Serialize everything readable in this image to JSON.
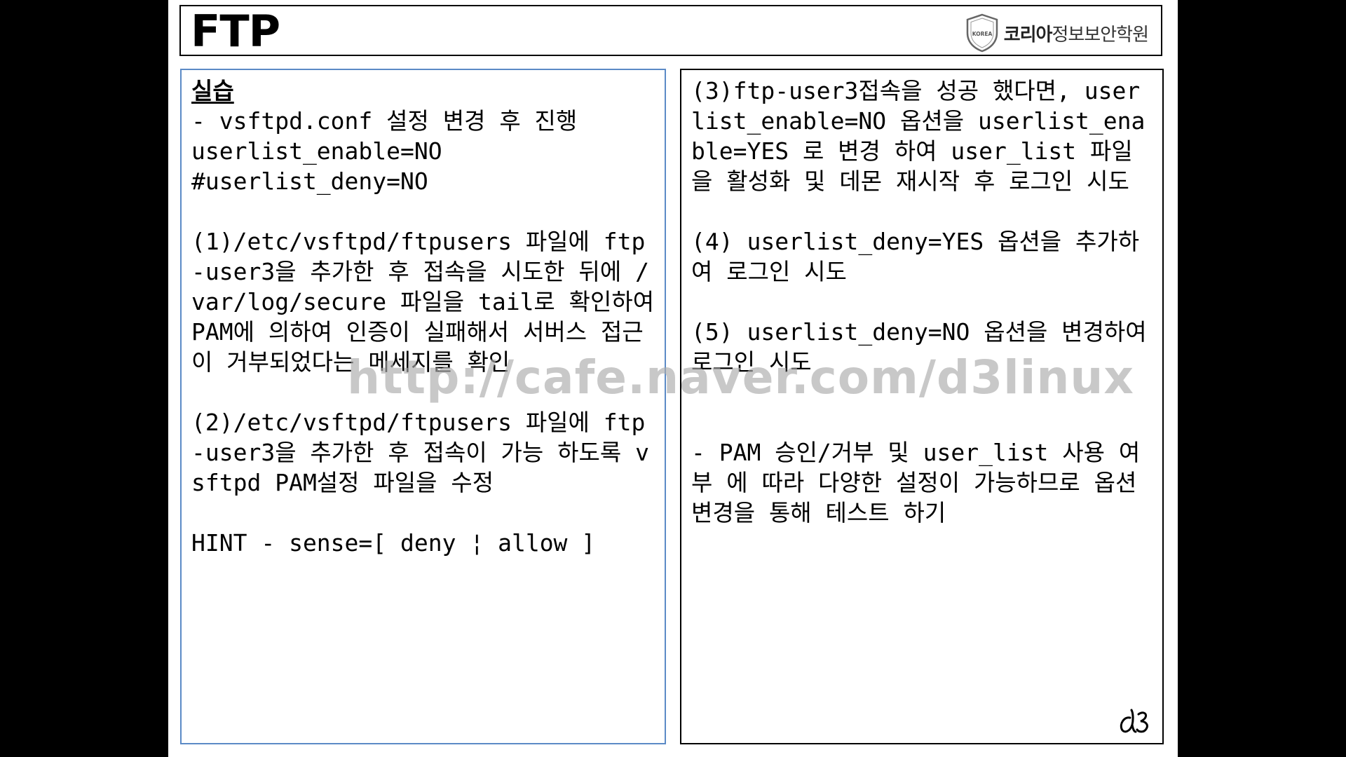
{
  "header": {
    "title": "FTP",
    "brand_bold": "코리아",
    "brand_rest": "정보보안학원",
    "shield_label": "KOREA"
  },
  "left_panel": {
    "heading": "실습",
    "lines": [
      "- vsftpd.conf 설정 변경 후 진행",
      "userlist_enable=NO",
      "#userlist_deny=NO",
      "",
      "(1)/etc/vsftpd/ftpusers 파일에 ftp-user3을 추가한 후 접속을 시도한 뒤에 /var/log/secure 파일을 tail로 확인하여 PAM에 의하여 인증이 실패해서 서버스 접근이 거부되었다는 메세지를 확인",
      "",
      "(2)/etc/vsftpd/ftpusers 파일에 ftp-user3을 추가한 후 접속이 가능 하도록 vsftpd PAM설정 파일을 수정",
      "",
      "HINT - sense=[ deny ¦ allow ]"
    ]
  },
  "right_panel": {
    "lines": [
      "(3)ftp-user3접속을 성공 했다면, userlist_enable=NO 옵션을 userlist_enable=YES 로 변경 하여 user_list 파일을 활성화 및 데몬 재시작 후 로그인 시도",
      "",
      "(4) userlist_deny=YES 옵션을 추가하여 로그인 시도",
      "",
      "(5) userlist_deny=NO 옵션을 변경하여 로그인 시도",
      "",
      "",
      "- PAM 승인/거부 및 user_list 사용 여부 에 따라 다양한 설정이 가능하므로 옵션 변경을 통해 테스트 하기"
    ]
  },
  "watermark": "http://cafe.naver.com/d3linux",
  "colors": {
    "left_border": "#5b8ac6",
    "right_border": "#000000",
    "page_background": "#000000"
  }
}
